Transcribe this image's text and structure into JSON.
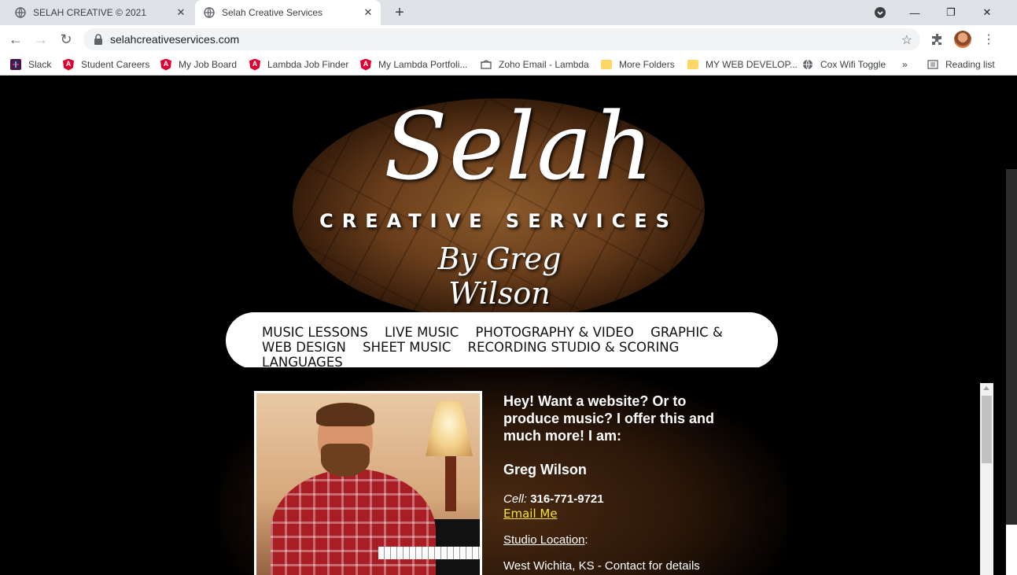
{
  "browser": {
    "tabs": [
      {
        "title": "SELAH CREATIVE © 2021"
      },
      {
        "title": "Selah Creative Services"
      }
    ],
    "address": "selahcreativeservices.com",
    "bookmarks": [
      {
        "label": "Slack",
        "icon": "slack-icon"
      },
      {
        "label": "Student Careers",
        "icon": "angular-icon"
      },
      {
        "label": "My Job Board",
        "icon": "angular-icon"
      },
      {
        "label": "Lambda Job Finder",
        "icon": "angular-icon"
      },
      {
        "label": "My Lambda Portfoli...",
        "icon": "angular-icon"
      },
      {
        "label": "Zoho Email - Lambda",
        "icon": "mail-icon"
      },
      {
        "label": "More Folders",
        "icon": "folder-icon"
      },
      {
        "label": "MY WEB DEVELOP...",
        "icon": "folder-icon"
      },
      {
        "label": "Cox Wifi Toggle",
        "icon": "globe-icon"
      }
    ],
    "reading_list": "Reading list",
    "overflow": "»"
  },
  "logo": {
    "main": "Selah",
    "sub": "CREATIVE SERVICES",
    "by": "By Greg Wilson"
  },
  "nav": {
    "items": [
      "MUSIC LESSONS",
      "LIVE MUSIC",
      "PHOTOGRAPHY & VIDEO",
      "GRAPHIC & WEB DESIGN",
      "SHEET MUSIC",
      "RECORDING STUDIO & SCORING",
      "LANGUAGES"
    ]
  },
  "info": {
    "headline": "Hey! Want a website? Or to produce music? I offer this and much more! I am:",
    "name": "Greg Wilson",
    "cell_label": "Cell",
    "cell_number": "316-771-9721",
    "email_label": "Email Me",
    "studio_label": "Studio Location",
    "location": "West Wichita, KS - Contact for details"
  }
}
